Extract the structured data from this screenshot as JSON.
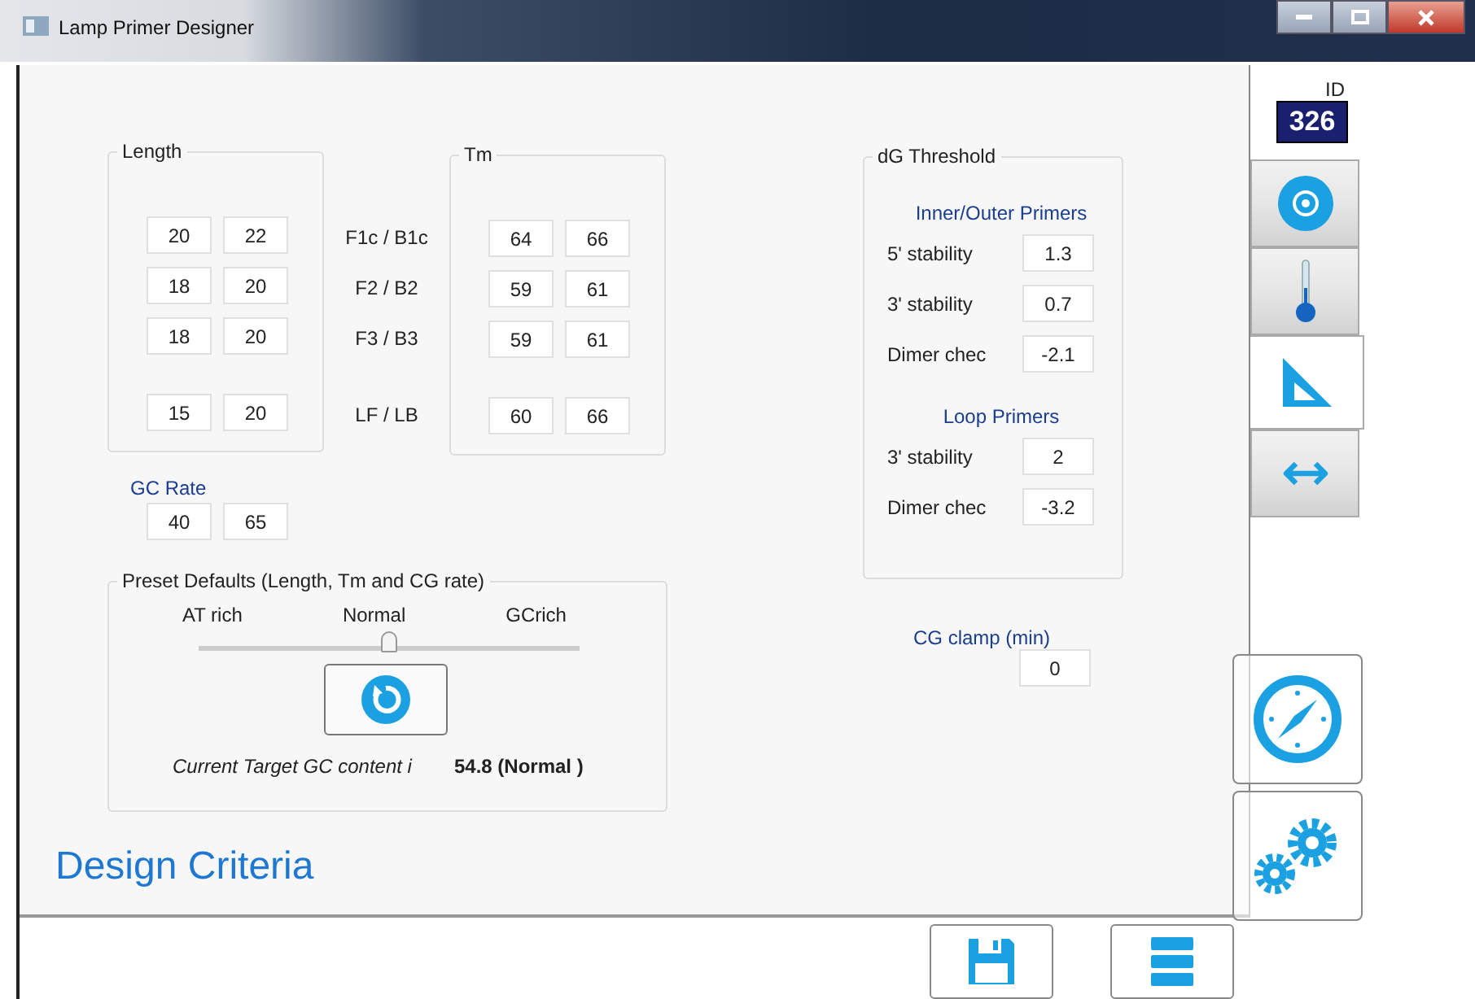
{
  "window": {
    "title": "Lamp Primer Designer"
  },
  "id_badge": {
    "label": "ID",
    "value": "326"
  },
  "length": {
    "title": "Length",
    "rows": [
      {
        "min": "20",
        "max": "22"
      },
      {
        "min": "18",
        "max": "20"
      },
      {
        "min": "18",
        "max": "20"
      },
      {
        "min": "15",
        "max": "20"
      }
    ]
  },
  "row_labels": [
    "F1c / B1c",
    "F2 / B2",
    "F3 / B3",
    "LF / LB"
  ],
  "tm": {
    "title": "Tm",
    "rows": [
      {
        "min": "64",
        "max": "66"
      },
      {
        "min": "59",
        "max": "61"
      },
      {
        "min": "59",
        "max": "61"
      },
      {
        "min": "60",
        "max": "66"
      }
    ]
  },
  "gc_rate": {
    "label": "GC Rate",
    "min": "40",
    "max": "65"
  },
  "preset": {
    "title": "Preset Defaults (Length, Tm and CG rate)",
    "ticks": [
      "AT rich",
      "Normal",
      "GCrich"
    ],
    "level": 0.5,
    "target_label": "Current Target GC content i",
    "target_value": "54.8 (Normal )"
  },
  "dg_threshold": {
    "title": "dG Threshold",
    "sections": [
      {
        "title": "Inner/Outer Primers",
        "rows": [
          {
            "label": "5' stability",
            "value": "1.3"
          },
          {
            "label": "3' stability",
            "value": "0.7"
          },
          {
            "label": "Dimer chec",
            "value": "-2.1"
          }
        ]
      },
      {
        "title": "Loop Primers",
        "rows": [
          {
            "label": "3' stability",
            "value": "2"
          },
          {
            "label": "Dimer chec",
            "value": "-3.2"
          }
        ]
      }
    ]
  },
  "cg_clamp": {
    "label": "CG clamp (min)",
    "value": "0"
  },
  "heading": "Design Criteria",
  "side_tabs": [
    {
      "kind": "disc",
      "selected": false
    },
    {
      "kind": "thermometer",
      "selected": false
    },
    {
      "kind": "triangle",
      "selected": true
    },
    {
      "kind": "arrows",
      "selected": false
    }
  ],
  "side_buttons": [
    {
      "kind": "compass"
    },
    {
      "kind": "gears"
    }
  ],
  "bottom_buttons": [
    {
      "kind": "save"
    },
    {
      "kind": "list"
    }
  ]
}
